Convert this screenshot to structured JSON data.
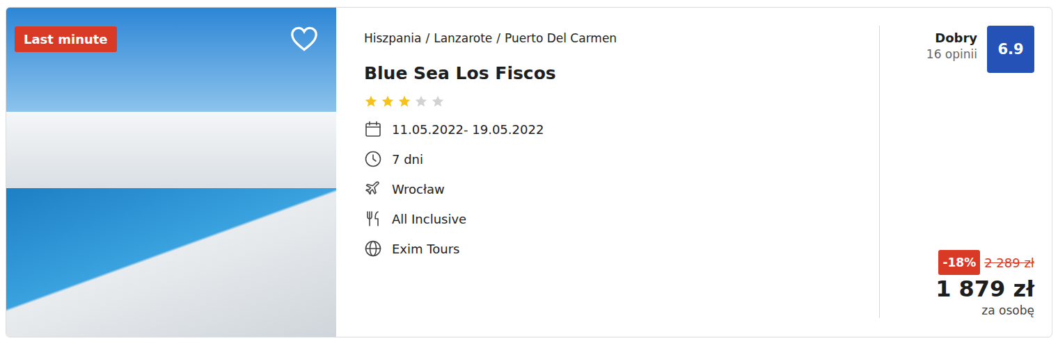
{
  "offer": {
    "badge": "Last minute",
    "favorite": false,
    "breadcrumb": {
      "items": [
        "Hiszpania",
        "Lanzarote",
        "Puerto Del Carmen"
      ],
      "separator": "/"
    },
    "title": "Blue Sea Los Fiscos",
    "stars": 3,
    "star_count": 5,
    "details": [
      {
        "kind": "dates",
        "text": "11.05.2022- 19.05.2022"
      },
      {
        "kind": "duration",
        "text": "7 dni"
      },
      {
        "kind": "departure",
        "text": "Wrocław"
      },
      {
        "kind": "board",
        "text": "All Inclusive"
      },
      {
        "kind": "operator",
        "text": "Exim Tours"
      }
    ],
    "rating": {
      "label": "Dobry",
      "reviews": "16 opinii",
      "score": "6.9"
    },
    "price": {
      "discount": "-18%",
      "old": "2 289 zł",
      "current": "1 879 zł",
      "per": "za osobę"
    }
  }
}
